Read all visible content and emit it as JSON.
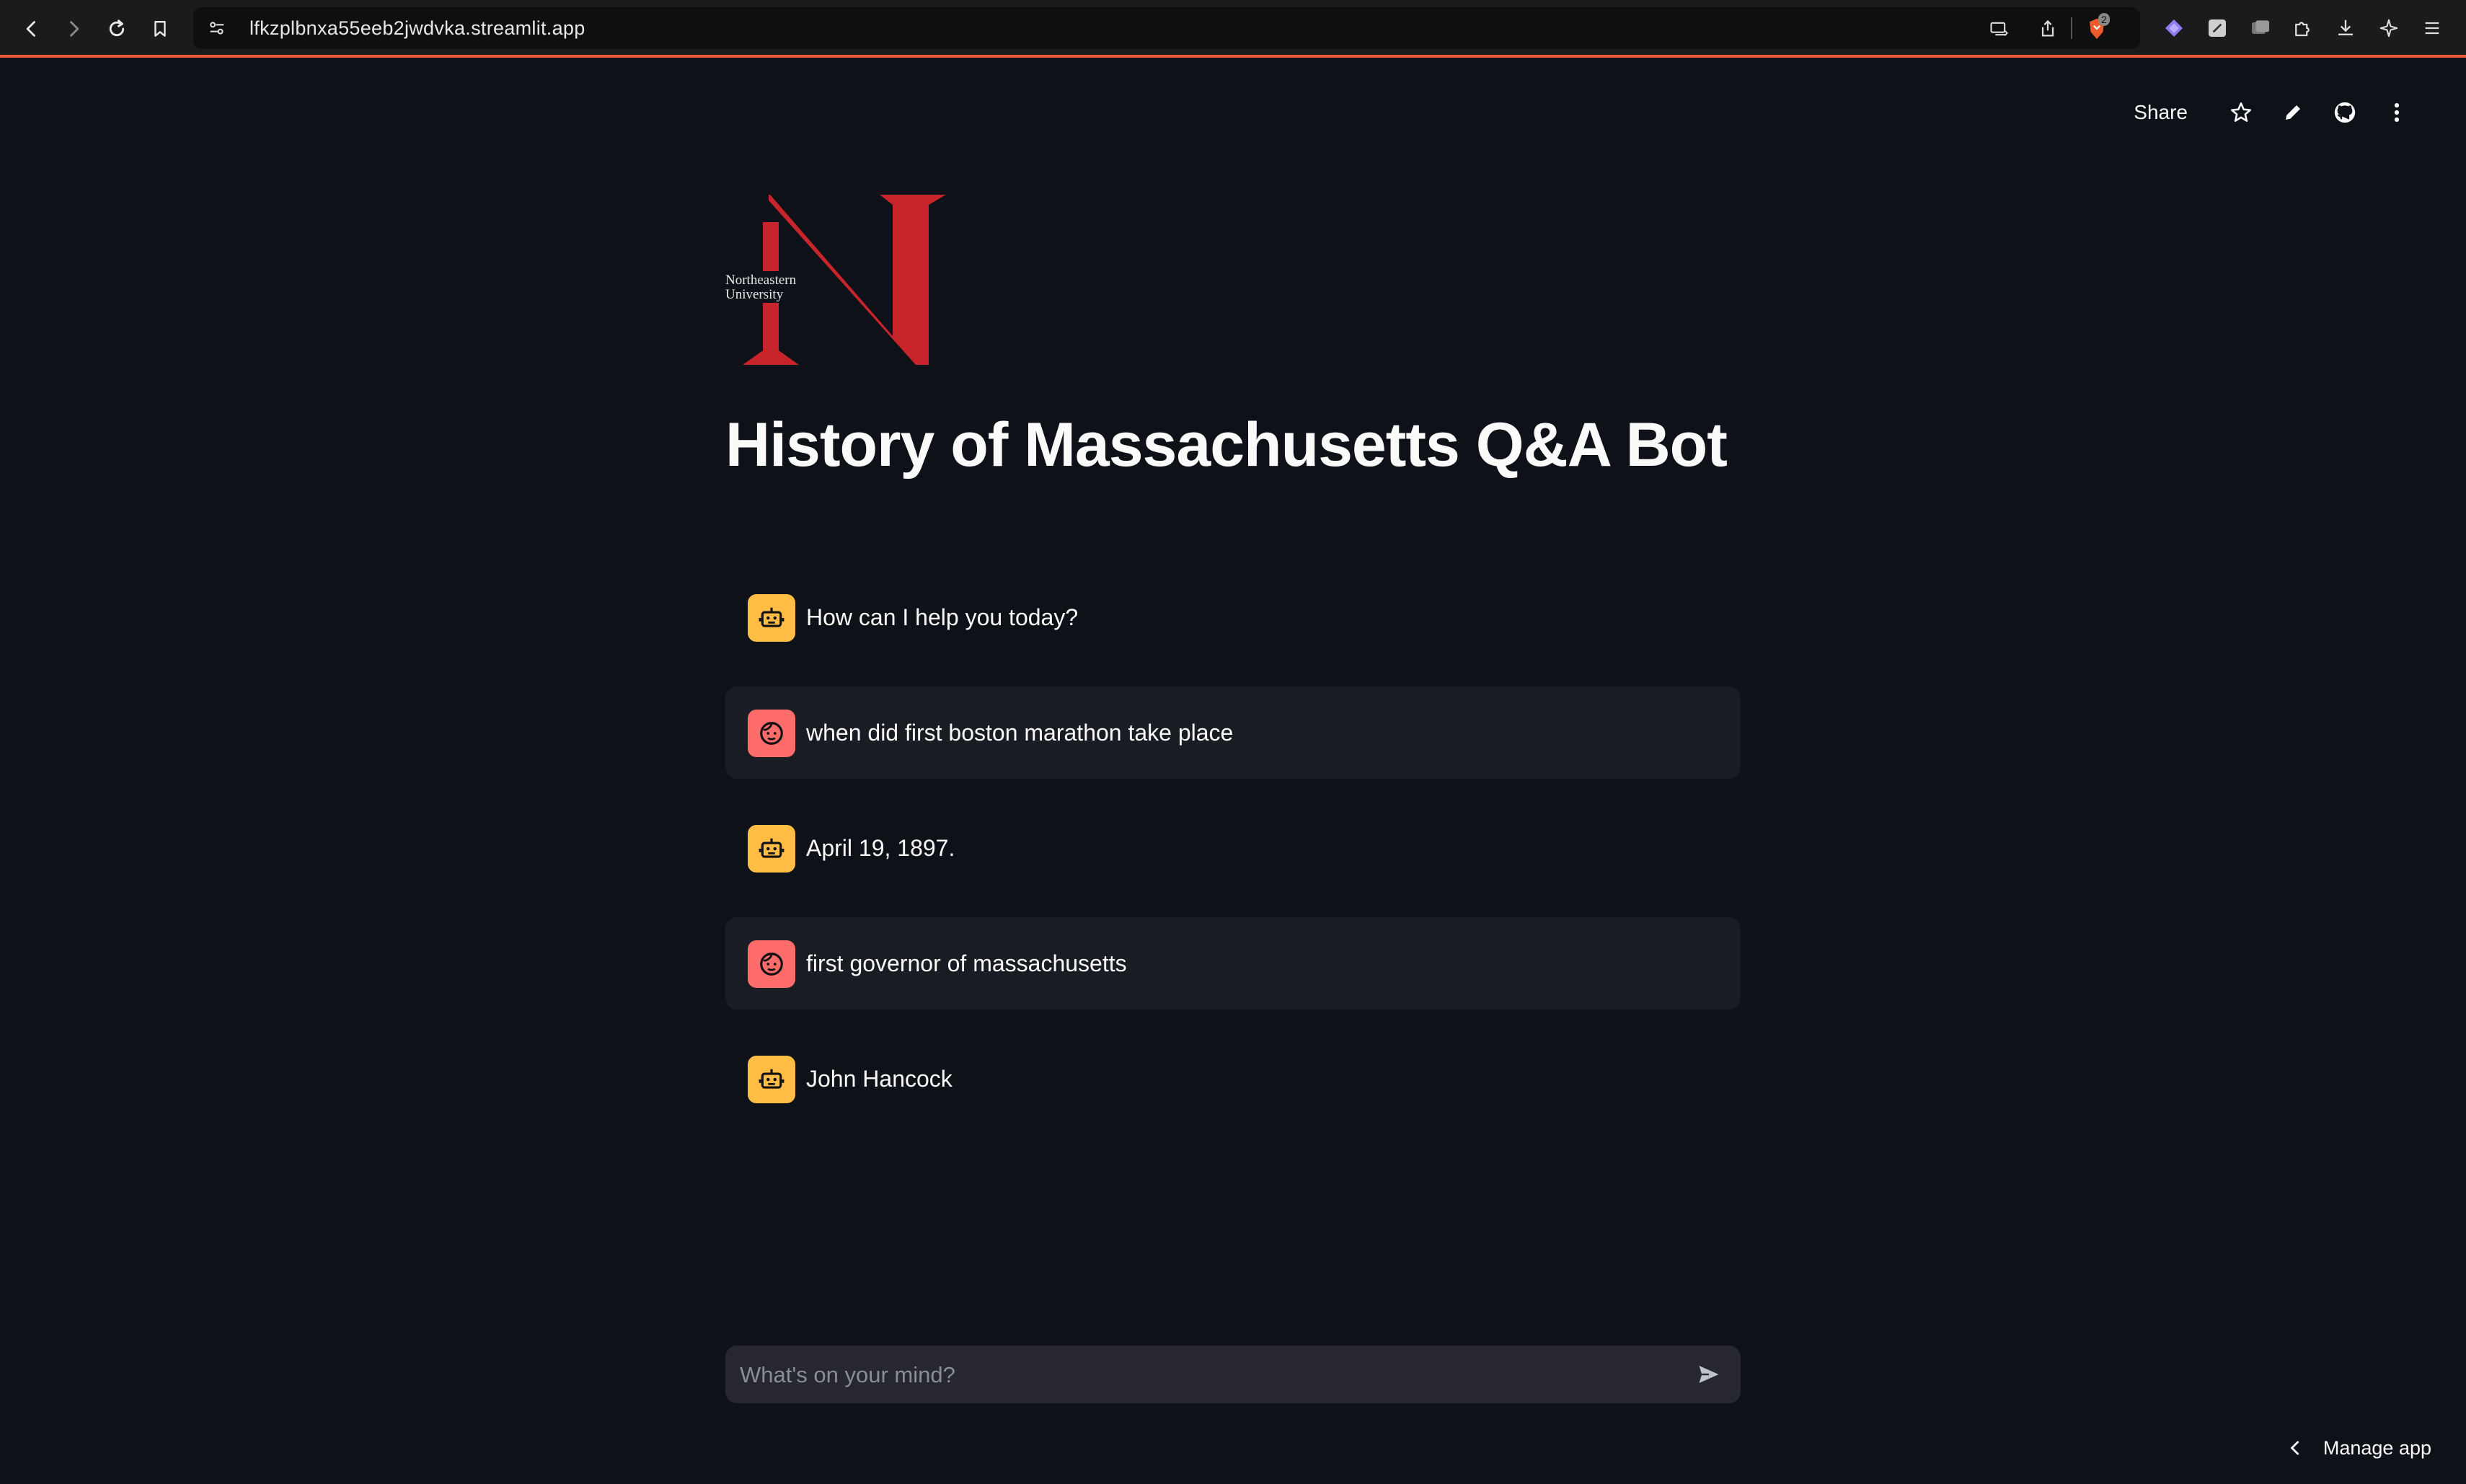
{
  "browser": {
    "url": "lfkzplbnxa55eeb2jwdvka.streamlit.app",
    "brave_badge": "2"
  },
  "toolbar": {
    "share_label": "Share"
  },
  "logo": {
    "line1": "Northeastern",
    "line2": "University",
    "color": "#c8242b"
  },
  "page": {
    "title": "History of Massachusetts Q&A Bot"
  },
  "messages": [
    {
      "role": "assistant",
      "text": "How can I help you today?"
    },
    {
      "role": "user",
      "text": "when did first boston marathon take place"
    },
    {
      "role": "assistant",
      "text": "April 19, 1897."
    },
    {
      "role": "user",
      "text": "first governor of massachusetts"
    },
    {
      "role": "assistant",
      "text": "John Hancock"
    }
  ],
  "chat_input": {
    "placeholder": "What's on your mind?"
  },
  "footer": {
    "manage_app_label": "Manage app"
  },
  "colors": {
    "background": "#0e1117",
    "user_bubble": "#1a1c24",
    "bot_avatar": "#ffbd45",
    "user_avatar": "#ff6c6c",
    "input_bg": "#262730"
  }
}
